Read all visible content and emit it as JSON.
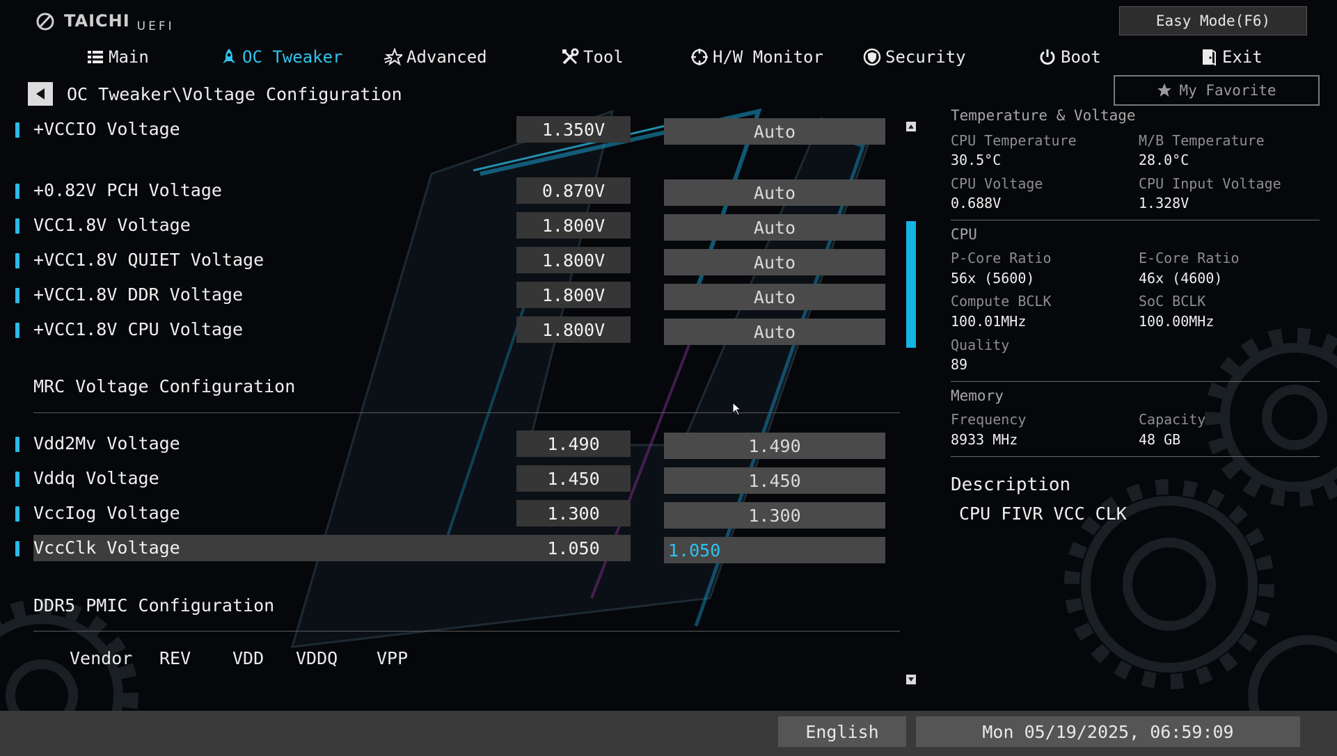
{
  "header": {
    "brand": "TAICHI",
    "uefi": "UEFI",
    "easy_mode": "Easy Mode(F6)",
    "my_favorite": "My Favorite"
  },
  "nav": {
    "tabs": [
      {
        "label": "Main",
        "icon": "list-icon"
      },
      {
        "label": "OC Tweaker",
        "icon": "rocket-icon",
        "active": true
      },
      {
        "label": "Advanced",
        "icon": "star-icon"
      },
      {
        "label": "Tool",
        "icon": "tools-icon"
      },
      {
        "label": "H/W Monitor",
        "icon": "crosshair-icon"
      },
      {
        "label": "Security",
        "icon": "shield-icon"
      },
      {
        "label": "Boot",
        "icon": "power-icon"
      },
      {
        "label": "Exit",
        "icon": "exit-icon"
      }
    ]
  },
  "breadcrumb": "OC Tweaker\\Voltage Configuration",
  "settings": [
    {
      "label": "+VCCIO Voltage",
      "value": "1.350V",
      "field": "Auto"
    },
    {
      "label": "+0.82V PCH Voltage",
      "value": "0.870V",
      "field": "Auto"
    },
    {
      "label": "VCC1.8V Voltage",
      "value": "1.800V",
      "field": "Auto"
    },
    {
      "label": "+VCC1.8V QUIET Voltage",
      "value": "1.800V",
      "field": "Auto"
    },
    {
      "label": "+VCC1.8V DDR Voltage",
      "value": "1.800V",
      "field": "Auto"
    },
    {
      "label": "+VCC1.8V CPU Voltage",
      "value": "1.800V",
      "field": "Auto"
    },
    {
      "label": "Vdd2Mv Voltage",
      "value": "1.490",
      "field": "1.490"
    },
    {
      "label": "Vddq Voltage",
      "value": "1.450",
      "field": "1.450"
    },
    {
      "label": "VccIog Voltage",
      "value": "1.300",
      "field": "1.300"
    },
    {
      "label": "VccClk Voltage",
      "value": "1.050",
      "field": "1.050"
    }
  ],
  "sections": {
    "mrc": "MRC Voltage Configuration",
    "ddr5": "DDR5 PMIC Configuration"
  },
  "pmic_columns": [
    "Vendor",
    "REV",
    "VDD",
    "VDDQ",
    "VPP"
  ],
  "panel": {
    "temp_title": "Temperature & Voltage",
    "cpu_temp_label": "CPU Temperature",
    "cpu_temp": "30.5°C",
    "mb_temp_label": "M/B Temperature",
    "mb_temp": "28.0°C",
    "cpu_volt_label": "CPU Voltage",
    "cpu_volt": "0.688V",
    "cpu_in_volt_label": "CPU Input Voltage",
    "cpu_in_volt": "1.328V",
    "cpu_title": "CPU",
    "pcore_label": "P-Core Ratio",
    "pcore": "56x (5600)",
    "ecore_label": "E-Core Ratio",
    "ecore": "46x (4600)",
    "bclk_label": "Compute BCLK",
    "bclk": "100.01MHz",
    "soc_label": "SoC BCLK",
    "soc": "100.00MHz",
    "quality_label": "Quality",
    "quality": "89",
    "mem_title": "Memory",
    "freq_label": "Frequency",
    "freq": "8933 MHz",
    "cap_label": "Capacity",
    "cap": "48 GB",
    "desc_title": "Description",
    "desc_text": "CPU FIVR VCC CLK"
  },
  "footer": {
    "language": "English",
    "datetime": "Mon 05/19/2025, 06:59:09"
  },
  "colors": {
    "accent": "#2fc4ee",
    "background": "#05070a",
    "footer": "#3a3a3a"
  }
}
